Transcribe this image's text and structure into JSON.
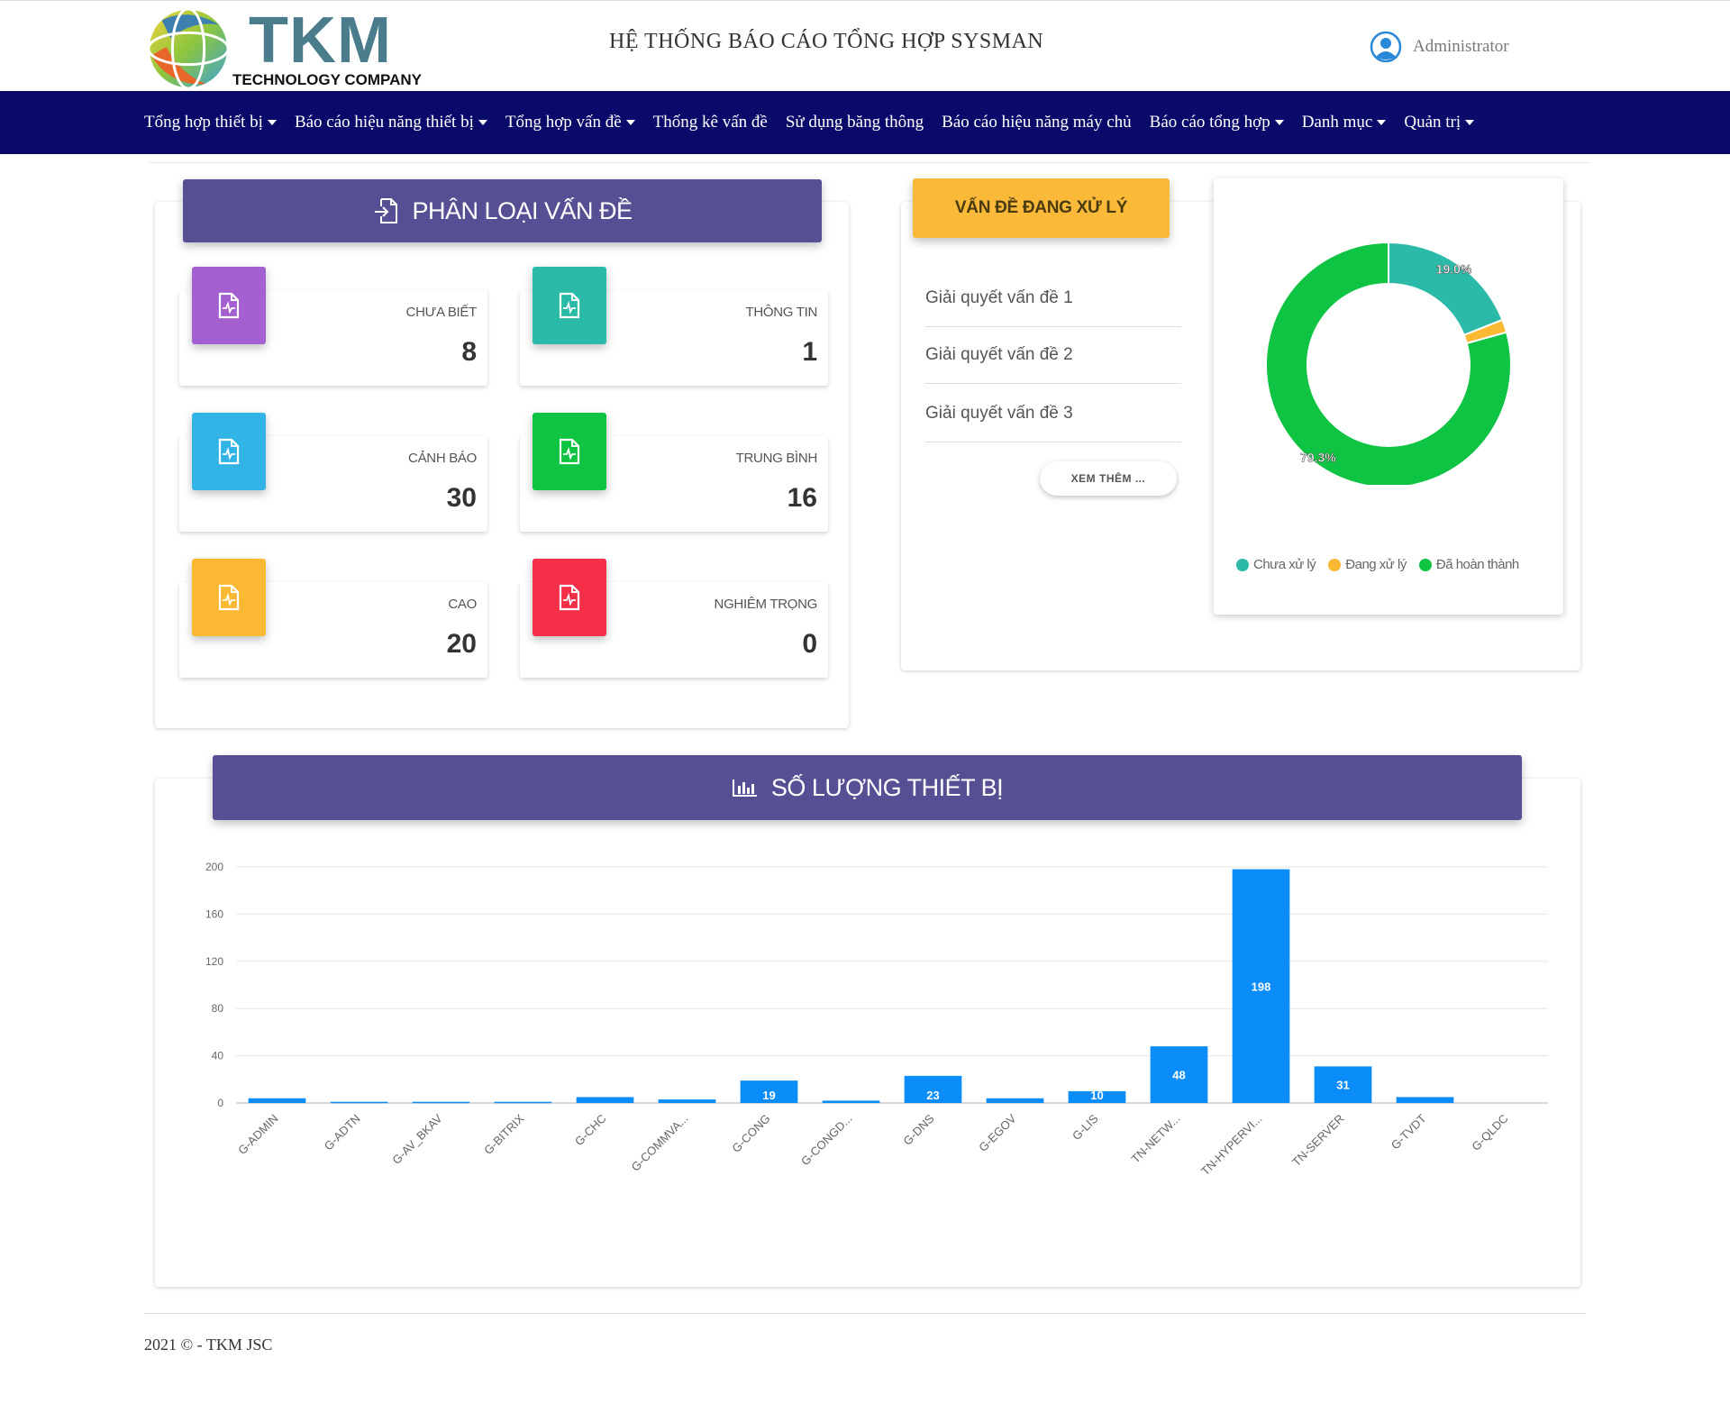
{
  "header": {
    "logo_text": "TKM",
    "logo_subtitle": "TECHNOLOGY COMPANY",
    "system_title": "HỆ THỐNG BÁO CÁO TỔNG HỢP SYSMAN",
    "user_name": "Administrator"
  },
  "nav": {
    "items": [
      {
        "label": "Tổng hợp thiết bị",
        "dropdown": true
      },
      {
        "label": "Báo cáo hiệu năng thiết bị",
        "dropdown": true
      },
      {
        "label": "Tổng hợp vấn đề",
        "dropdown": true
      },
      {
        "label": "Thống kê vấn đề",
        "dropdown": false
      },
      {
        "label": "Sử dụng băng thông",
        "dropdown": false
      },
      {
        "label": "Báo cáo hiệu năng máy chủ",
        "dropdown": false
      },
      {
        "label": "Báo cáo tổng hợp",
        "dropdown": true
      },
      {
        "label": "Danh mục",
        "dropdown": true
      },
      {
        "label": "Quản trị",
        "dropdown": true
      }
    ]
  },
  "classification": {
    "title": "PHÂN LOẠI VẤN ĐỀ",
    "stats": [
      {
        "label": "CHƯA BIẾT",
        "value": "8",
        "color": "#a45fd0"
      },
      {
        "label": "THÔNG TIN",
        "value": "1",
        "color": "#2bbaa8"
      },
      {
        "label": "CẢNH BÁO",
        "value": "30",
        "color": "#33b4e6"
      },
      {
        "label": "TRUNG BÌNH",
        "value": "16",
        "color": "#0ec442"
      },
      {
        "label": "CAO",
        "value": "20",
        "color": "#fbb833"
      },
      {
        "label": "NGHIÊM TRỌNG",
        "value": "0",
        "color": "#f52f47"
      }
    ]
  },
  "issues": {
    "title": "VẤN ĐỀ ĐANG XỬ LÝ",
    "items": [
      "Giải quyết vấn đề 1",
      "Giải quyết vấn đề 2",
      "Giải quyết vấn đề 3"
    ],
    "more_label": "XEM THÊM ..."
  },
  "donut": {
    "slices": [
      {
        "name": "Chưa xử lý",
        "percent": 19.0,
        "label": "19.0%",
        "color": "#2bbaa8"
      },
      {
        "name": "Đang xử lý",
        "percent": 1.7,
        "label": "",
        "color": "#fbb833"
      },
      {
        "name": "Đã hoàn thành",
        "percent": 79.3,
        "label": "79.3%",
        "color": "#0ec442"
      }
    ]
  },
  "devices": {
    "title": "SỐ LƯỢNG THIẾT BỊ"
  },
  "chart_data": {
    "type": "bar",
    "title": "SỐ LƯỢNG THIẾT BỊ",
    "xlabel": "",
    "ylabel": "",
    "ylim": [
      0,
      200
    ],
    "yticks": [
      0,
      40,
      80,
      120,
      160,
      200
    ],
    "grid": true,
    "bar_color": "#0a8df8",
    "categories": [
      "G-ADMIN",
      "G-ADTN",
      "G-AV_BKAV",
      "G-BITRIX",
      "G-CHC",
      "G-COMMVA...",
      "G-CONG",
      "G-CONGD...",
      "G-DNS",
      "G-EGOV",
      "G-LIS",
      "TN-NETW...",
      "TN-HYPERVI...",
      "TN-SERVER",
      "G-TVDT",
      "G-QLDC"
    ],
    "values": [
      4,
      1,
      1,
      1,
      5,
      3,
      19,
      2,
      23,
      4,
      10,
      48,
      198,
      31,
      5
    ],
    "labels": [
      "",
      "",
      "",
      "",
      "",
      "",
      "19",
      "",
      "23",
      "",
      "10",
      "48",
      "198",
      "31",
      ""
    ]
  },
  "footer": {
    "text": "2021 © - TKM JSC"
  }
}
